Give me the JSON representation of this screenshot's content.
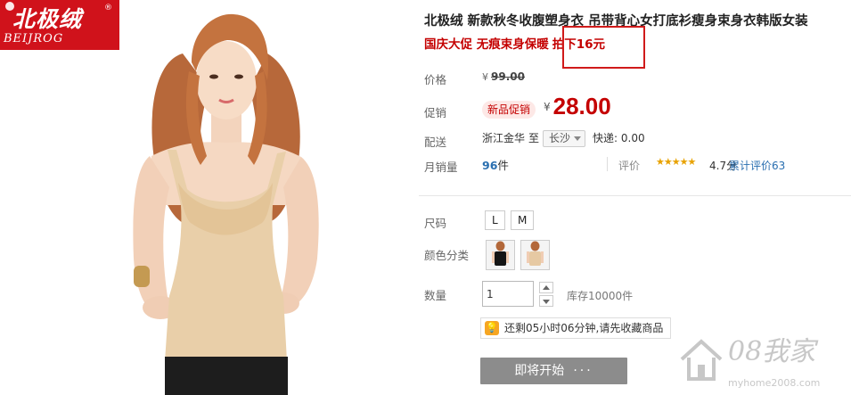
{
  "brand": {
    "name_cn": "北极绒",
    "name_en": "BEIJROG",
    "registered_mark": "®"
  },
  "product": {
    "title": "北极绒 新款秋冬收腹塑身衣 吊带背心女打底衫瘦身束身衣韩版女装",
    "promo_line_a": "国庆大促 无痕束身保暖",
    "promo_line_b": "拍下16元"
  },
  "price": {
    "label": "价格",
    "currency": "¥",
    "original": "99.00"
  },
  "promotion": {
    "label": "促销",
    "badge": "新品促销",
    "currency": "¥",
    "price": "28.00"
  },
  "shipping": {
    "label": "配送",
    "from": "浙江金华",
    "to_word": "至",
    "destination": "长沙",
    "fee": "快递: 0.00"
  },
  "sales": {
    "label": "月销量",
    "count": "96",
    "unit": "件",
    "rating_label": "评价",
    "stars": "★★★★★",
    "rating_score": "4.7分",
    "cumulative_reviews": "累计评价63"
  },
  "options": {
    "size_label": "尺码",
    "sizes": [
      "L",
      "M"
    ],
    "color_label": "颜色分类",
    "colors": [
      "black",
      "nude"
    ]
  },
  "quantity": {
    "label": "数量",
    "value": "1",
    "stock": "库存10000件"
  },
  "tip": {
    "text": "还剩05小时06分钟,请先收藏商品"
  },
  "action": {
    "start_label": "即将开始",
    "dots": "···"
  },
  "watermark": {
    "text": "08我家",
    "url": "myhome2008.com"
  },
  "colors": {
    "brand_red": "#d0121b",
    "price_red": "#c40000",
    "link_blue": "#2a6fb0",
    "button_gray": "#8c8c8c",
    "highlight_border": "#d01a1a"
  }
}
